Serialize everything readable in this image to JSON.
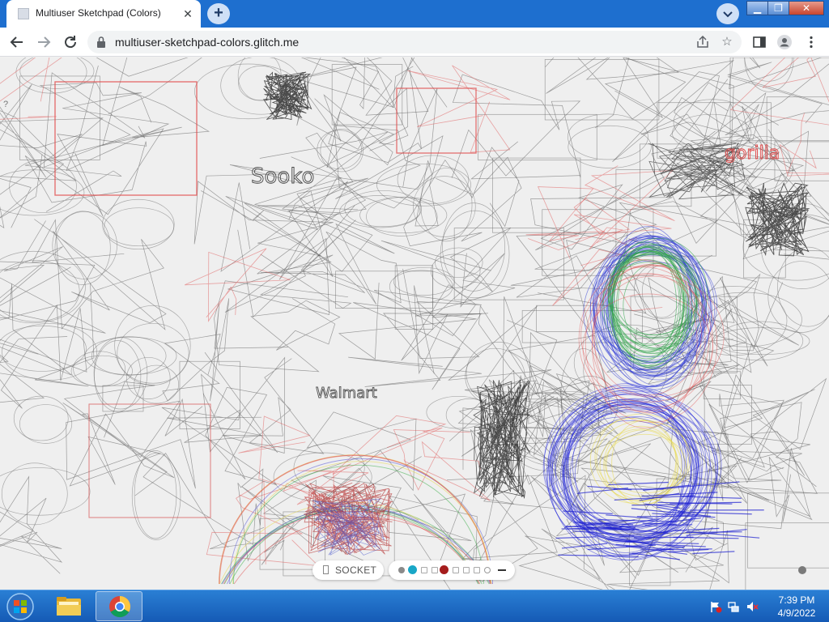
{
  "browser": {
    "tab_title": "Multiuser Sketchpad (Colors)",
    "url": "multiuser-sketchpad-colors.glitch.me",
    "accent_color": "#1e6fcf"
  },
  "icons": {
    "back": "back-arrow-icon",
    "forward": "forward-arrow-icon",
    "reload": "reload-icon",
    "lock": "lock-icon",
    "share": "share-icon",
    "bookmark": "star-icon",
    "sidepanel": "side-panel-icon",
    "profile": "profile-icon",
    "menu": "kebab-menu-icon"
  },
  "sketchpad": {
    "hint": "?",
    "socket_label": "SOCKET",
    "palette": {
      "colors": [
        "#8a8a8a",
        "#19a7c7",
        "#ffffff",
        "#ffffff",
        "#a51d1d",
        "#ffffff",
        "#ffffff",
        "#ffffff",
        "#ffffff"
      ],
      "selected_color": "#a51d1d"
    },
    "scribble_words": [
      "Sooko",
      "Walmart",
      "gorilla"
    ]
  },
  "taskbar": {
    "time": "7:39 PM",
    "date": "4/9/2022",
    "apps": [
      "start-orb",
      "file-explorer",
      "chrome"
    ]
  }
}
